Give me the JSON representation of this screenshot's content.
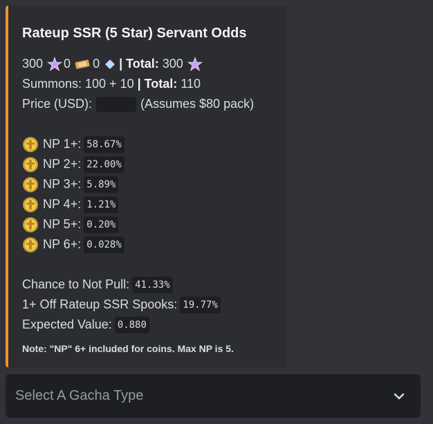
{
  "embed": {
    "accent_color": "#f0932b",
    "title": "Rateup SSR (5 Star) Servant Odds",
    "currency": {
      "saint_quartz": "300",
      "tickets": "0",
      "quartz_fragments": "0",
      "total_label": "| Total:",
      "total": "300"
    },
    "summons": {
      "label": "Summons: 100 + 10",
      "total_label": "| Total:",
      "total": "110"
    },
    "price": {
      "label": "Price (USD):",
      "note": "(Assumes $80 pack)"
    },
    "np_odds": [
      {
        "label": "NP 1+:",
        "value": "58.67%"
      },
      {
        "label": "NP 2+:",
        "value": "22.00%"
      },
      {
        "label": "NP 3+:",
        "value": "5.89%"
      },
      {
        "label": "NP 4+:",
        "value": "1.21%"
      },
      {
        "label": "NP 5+:",
        "value": "0.20%"
      },
      {
        "label": "NP 6+:",
        "value": "0.028%"
      }
    ],
    "stats": [
      {
        "label": "Chance to Not Pull:",
        "value": "41.33%"
      },
      {
        "label": "1+ Off Rateup SSR Spooks:",
        "value": "19.77%"
      },
      {
        "label": "Expected Value:",
        "value": "0.880"
      }
    ],
    "note": "Note: \"NP\" 6+ included for coins. Max NP is 5."
  },
  "select": {
    "placeholder": "Select A Gacha Type"
  },
  "icons": {
    "saint_quartz": "saint-quartz-icon",
    "ticket": "summon-ticket-icon",
    "quartz_fragment": "quartz-fragment-icon",
    "coin": "servant-coin-icon",
    "chevron": "chevron-down-icon"
  }
}
